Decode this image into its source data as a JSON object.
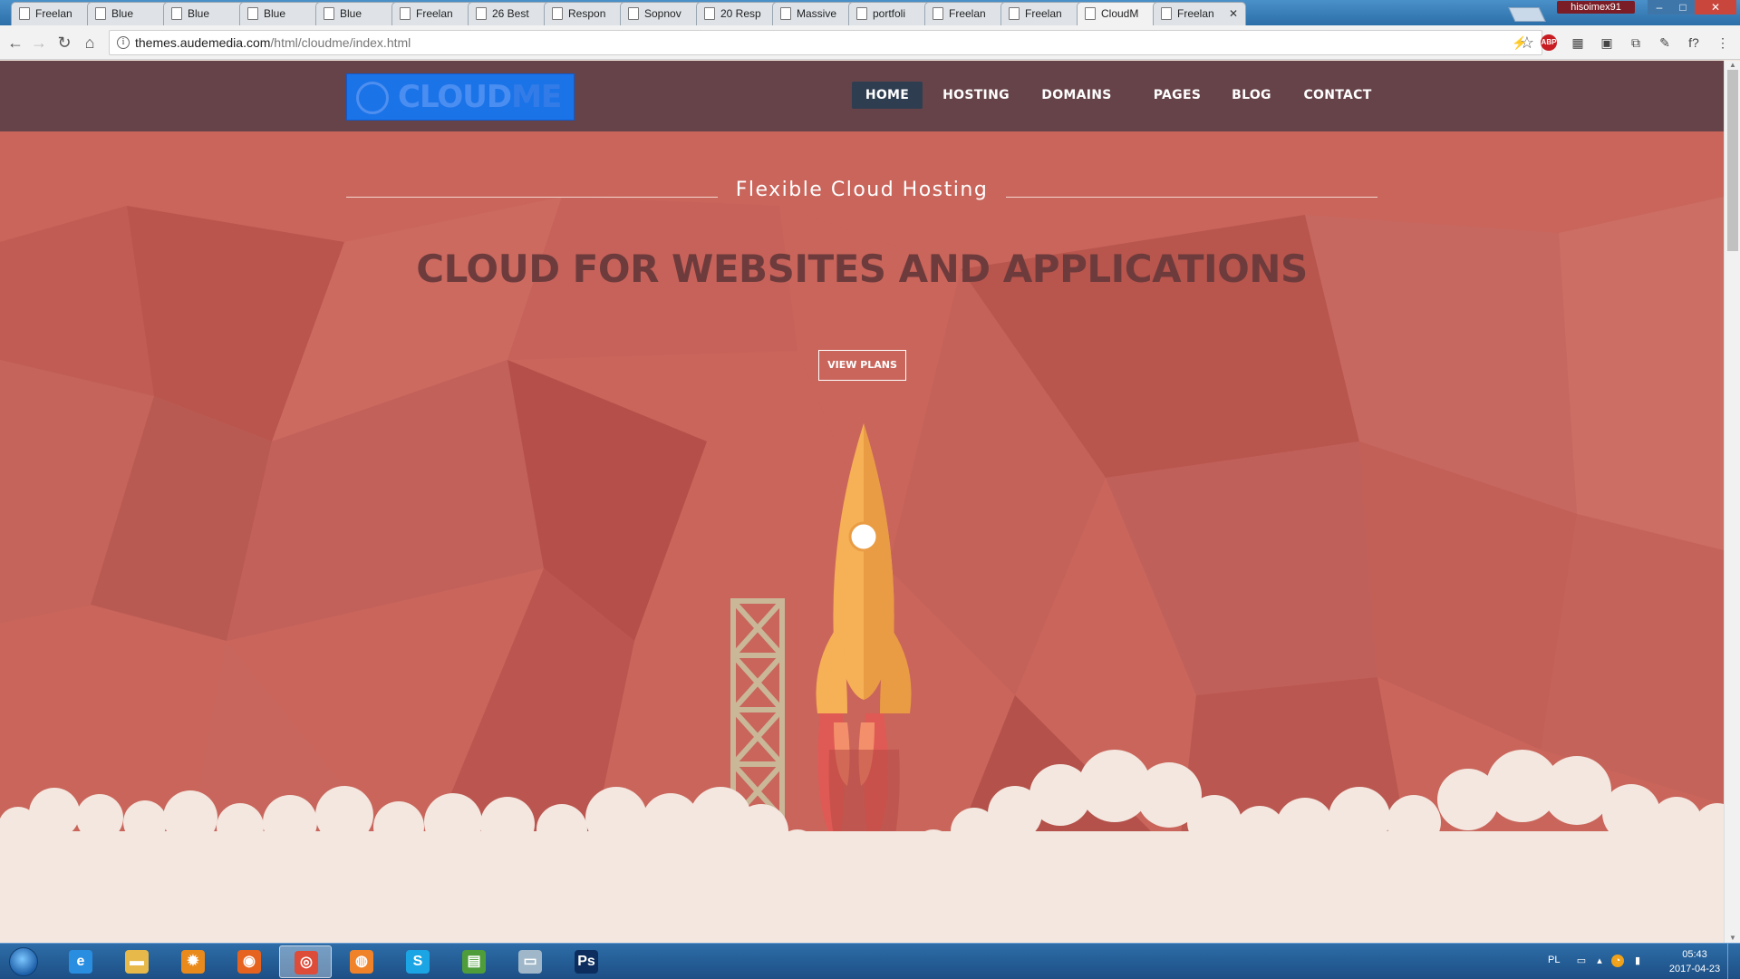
{
  "browser": {
    "tabs": [
      {
        "title": "Freelan",
        "close": "✕"
      },
      {
        "title": "Blue",
        "close": "✕"
      },
      {
        "title": "Blue",
        "close": "✕"
      },
      {
        "title": "Blue",
        "close": "✕"
      },
      {
        "title": "Blue",
        "close": "✕"
      },
      {
        "title": "Freelan",
        "close": "✕"
      },
      {
        "title": "26 Best",
        "close": "✕"
      },
      {
        "title": "Respon",
        "close": "✕"
      },
      {
        "title": "Sopnov",
        "close": "✕"
      },
      {
        "title": "20 Resp",
        "close": "✕"
      },
      {
        "title": "Massive",
        "close": "✕"
      },
      {
        "title": "portfoli",
        "close": "✕"
      },
      {
        "title": "Freelan",
        "close": "✕"
      },
      {
        "title": "Freelan",
        "close": "✕"
      },
      {
        "title": "CloudM",
        "close": "✕"
      },
      {
        "title": "Freelan",
        "close": "✕"
      }
    ],
    "active_tab_index": 14,
    "user_name": "hisoimex91",
    "window_buttons": {
      "minimize": "–",
      "maximize": "□",
      "close": "✕"
    },
    "nav": {
      "back": "←",
      "forward": "→",
      "reload": "↻",
      "home": "⌂"
    },
    "address": {
      "host": "themes.audemedia.com",
      "path": "/html/cloudme/index.html",
      "info": "i",
      "star": "☆"
    },
    "extensions": [
      {
        "name": "bolt-icon",
        "glyph": "⚡"
      },
      {
        "name": "adblock-icon",
        "glyph": "ABP"
      },
      {
        "name": "grid-extension-icon",
        "glyph": "▦"
      },
      {
        "name": "camera-extension-icon",
        "glyph": "▣"
      },
      {
        "name": "puzzle-extension-icon",
        "glyph": "⧉"
      },
      {
        "name": "pen-extension-icon",
        "glyph": "✎"
      },
      {
        "name": "function-extension-icon",
        "glyph": "f?"
      },
      {
        "name": "menu-kebab-icon",
        "glyph": "⋮"
      }
    ]
  },
  "site": {
    "logo": {
      "bold": "CLOUD",
      "light": "ME"
    },
    "nav": [
      "HOME",
      "HOSTING",
      "DOMAINS",
      "PAGES",
      "BLOG",
      "CONTACT"
    ],
    "active_nav": "HOME",
    "hero": {
      "subtitle": "Flexible Cloud Hosting",
      "title": "CLOUD FOR WEBSITES AND APPLICATIONS",
      "cta": "VIEW PLANS"
    },
    "colors": {
      "header_bg": "#664348",
      "hero_bg": "#c9655b",
      "title": "#6e3b3c",
      "cloud": "#f3e7df",
      "rocket_body": "#f6b055",
      "rocket_flame": "#e05a55",
      "tower": "#c9b798",
      "nav_active": "#2f3d51",
      "logo_bg": "#1b73e8"
    }
  },
  "taskbar": {
    "apps": [
      {
        "name": "internet-explorer-icon",
        "glyph": "e",
        "color": "#2a8ee0"
      },
      {
        "name": "file-explorer-icon",
        "glyph": "▬",
        "color": "#e6b94a"
      },
      {
        "name": "settings-gear-app-icon",
        "glyph": "✹",
        "color": "#e98a1c"
      },
      {
        "name": "firefox-icon",
        "glyph": "◉",
        "color": "#e6631f"
      },
      {
        "name": "chrome-icon",
        "glyph": "◎",
        "color": "#dd4b39"
      },
      {
        "name": "blender-icon",
        "glyph": "◍",
        "color": "#f0822a"
      },
      {
        "name": "skype-icon",
        "glyph": "S",
        "color": "#1ca5e4"
      },
      {
        "name": "chart-app-icon",
        "glyph": "▤",
        "color": "#4f9d3a"
      },
      {
        "name": "notes-app-icon",
        "glyph": "▭",
        "color": "#9fb7c8"
      },
      {
        "name": "photoshop-icon",
        "glyph": "Ps",
        "color": "#0c2d5e"
      }
    ],
    "active_app_index": 4,
    "tray": {
      "lang": "PL",
      "time": "05:43",
      "date": "2017-04-23"
    }
  }
}
